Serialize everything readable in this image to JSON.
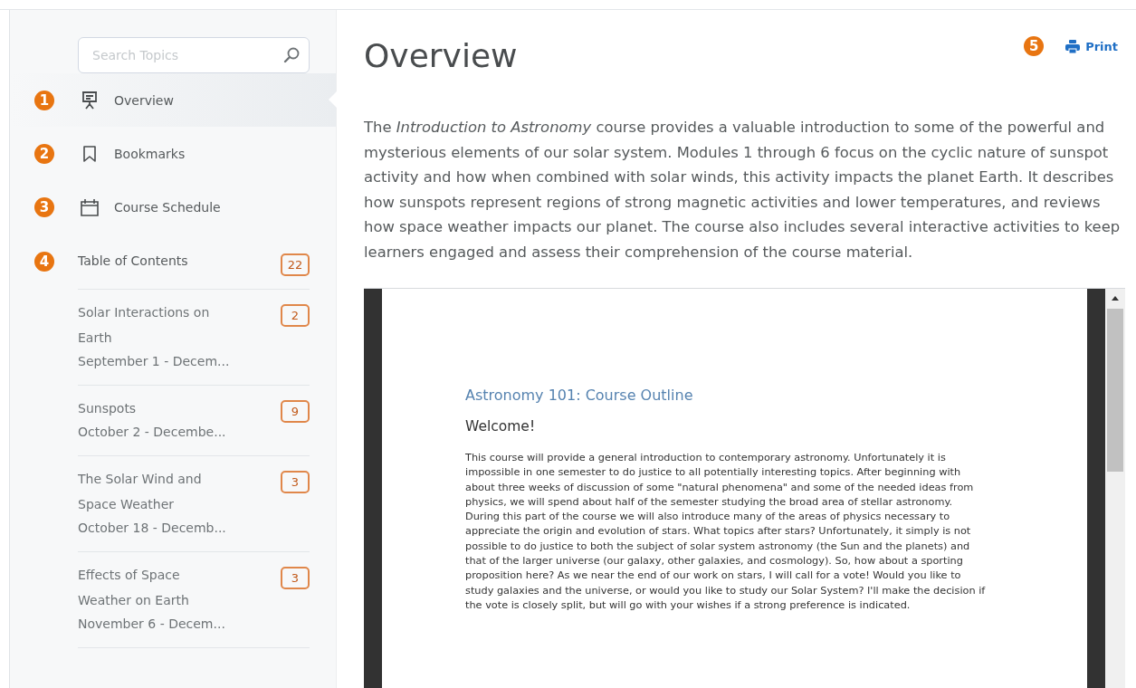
{
  "sidebar": {
    "search": {
      "placeholder": "Search Topics"
    },
    "nav": [
      {
        "callout": "1",
        "kind": "presentation",
        "label": "Overview",
        "selected": true
      },
      {
        "callout": "2",
        "kind": "bookmark",
        "label": "Bookmarks",
        "selected": false
      },
      {
        "callout": "3",
        "kind": "calendar",
        "label": "Course Schedule",
        "selected": false
      }
    ],
    "toc": {
      "callout": "4",
      "label": "Table of Contents",
      "count": "22",
      "modules": [
        {
          "title": "Solar Interactions on Earth",
          "dates": "September 1 - Decem...",
          "count": "2"
        },
        {
          "title": "Sunspots",
          "dates": "October 2 - Decembe...",
          "count": "9"
        },
        {
          "title": "The Solar Wind and Space Weather",
          "dates": "October 18 - Decemb...",
          "count": "3"
        },
        {
          "title": "Effects of Space Weather on Earth",
          "dates": "November 6 - Decem...",
          "count": "3"
        }
      ]
    }
  },
  "main": {
    "title": "Overview",
    "callout": "5",
    "print": "Print",
    "description": "The *Introduction to Astronomy* course provides a valuable introduction to some of the powerful and mysterious elements of our solar system. Modules 1 through 6 focus on the cyclic nature of sunspot activity and how when combined with solar winds, this activity impacts the planet Earth. It describes how sunspots represent regions of strong magnetic activities and lower temperatures, and reviews how space weather impacts our planet. The course also includes several interactive activities to keep learners engaged and assess their comprehension of the course material.",
    "document": {
      "heading": "Astronomy 101: Course Outline",
      "subheading": "Welcome!",
      "body": "This course will provide a general introduction to contemporary astronomy. Unfortunately it is impossible in one semester to do justice to all potentially interesting topics. After beginning with about three weeks of discussion of some \"natural phenomena\" and some of the needed ideas from physics, we will spend about half of the semester studying the broad area of stellar astronomy. During this part of the course we will also introduce many of the areas of physics necessary to appreciate the origin and evolution of stars. What topics after stars? Unfortunately, it simply is not possible to do justice to both the subject of solar system astronomy (the Sun and the planets) and that of the larger universe (our galaxy, other galaxies, and cosmology). So, how about a sporting proposition here? As we near the end of our work on stars, I will call for a vote! Would you like to study galaxies and the universe, or would you like to study our Solar System? I'll make the decision if the vote is closely split, but will go with your wishes if a strong preference is indicated."
    }
  }
}
